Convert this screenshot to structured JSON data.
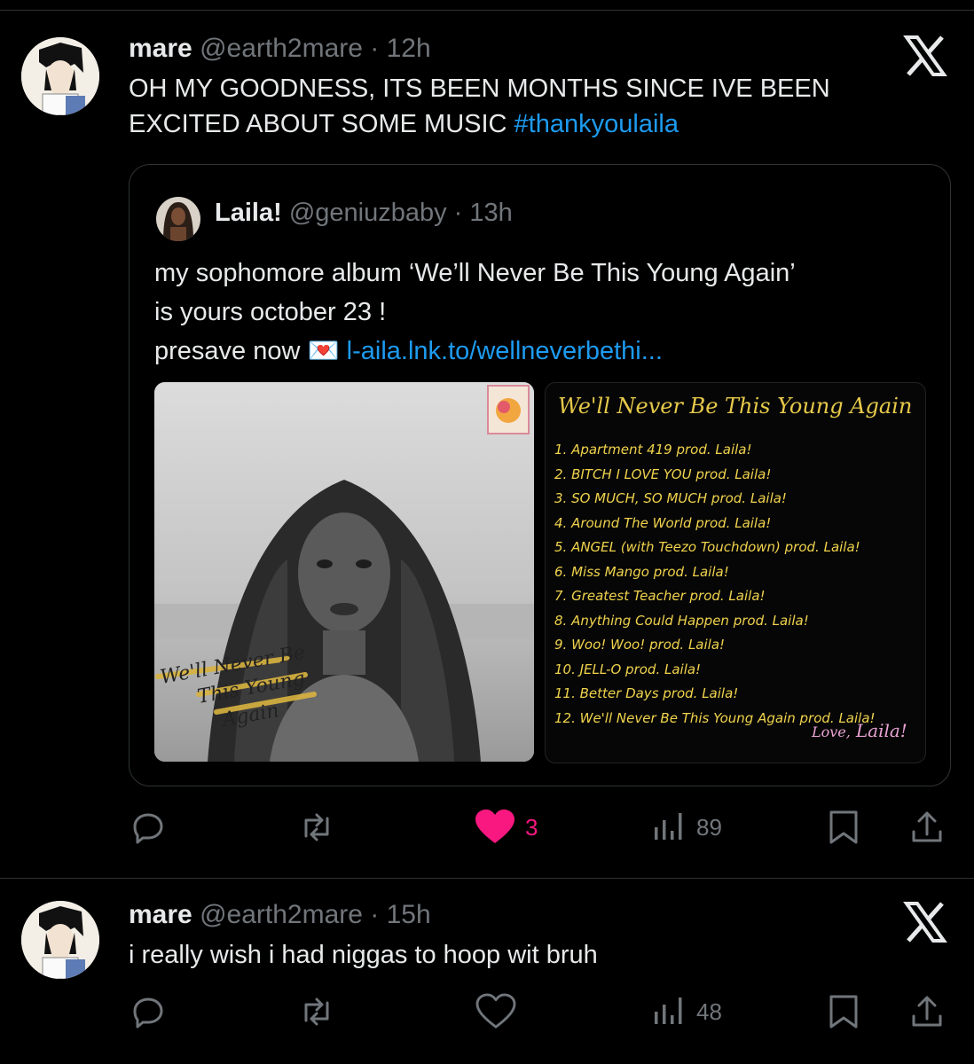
{
  "tweet1": {
    "name": "mare",
    "handle": "@earth2mare",
    "separator": "·",
    "time": "12h",
    "text": "OH MY GOODNESS, ITS BEEN MONTHS SINCE IVE BEEN EXCITED ABOUT SOME MUSIC ",
    "hashtag": "#thankyoulaila",
    "quote": {
      "name": "Laila!",
      "handle": "@geniuzbaby",
      "separator": "·",
      "time": "13h",
      "line1": "my sophomore album ‘We’ll Never Be This Young Again’",
      "line2": "is yours october 23 !",
      "line3_prefix": "presave now",
      "line3_emoji": "💌",
      "link": "l-aila.lnk.to/wellneverbethi...",
      "cover_text": "We'll Never Be This Young Again",
      "tracklist_title": "We'll Never Be This Young Again",
      "tracks": [
        "1. Apartment 419 prod. Laila!",
        "2. BITCH I LOVE YOU prod. Laila!",
        "3. SO MUCH, SO MUCH prod. Laila!",
        "4. Around The World prod. Laila!",
        "5. ANGEL (with Teezo Touchdown) prod. Laila!",
        "6. Miss Mango prod. Laila!",
        "7. Greatest Teacher prod. Laila!",
        "8. Anything Could Happen prod. Laila!",
        "9. Woo! Woo! prod. Laila!",
        "10. JELL-O prod. Laila!",
        "11. Better Days prod. Laila!",
        "12. We'll Never Be This Young Again prod. Laila!"
      ],
      "signoff": "Love,",
      "signature": "Laila!"
    },
    "actions": {
      "reply": "",
      "retweet": "",
      "likes": "3",
      "views": "89"
    }
  },
  "tweet2": {
    "name": "mare",
    "handle": "@earth2mare",
    "separator": "·",
    "time": "15h",
    "text": "i really wish i had niggas to hoop wit bruh",
    "actions": {
      "reply": "",
      "retweet": "",
      "likes": "",
      "views": "48"
    }
  },
  "colors": {
    "background": "#000000",
    "text": "#e7e9ea",
    "muted": "#71767b",
    "link": "#1d9bf0",
    "like": "#f91880",
    "border": "#2f3336"
  },
  "icons": [
    "reply-icon",
    "retweet-icon",
    "heart-icon",
    "views-icon",
    "bookmark-icon",
    "share-icon",
    "x-logo-icon"
  ]
}
